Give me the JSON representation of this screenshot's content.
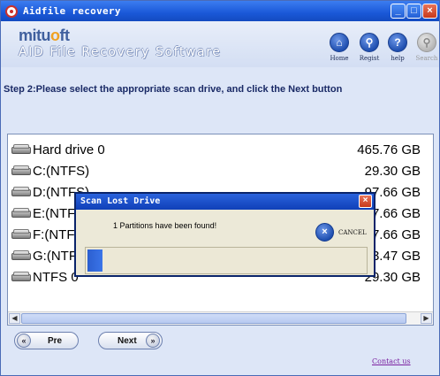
{
  "window": {
    "title": "Aidfile recovery",
    "controls": {
      "minimize": "_",
      "maximize": "□",
      "close": "×"
    }
  },
  "brand": {
    "logo_prefix": "mitu",
    "logo_o": "o",
    "logo_suffix": "ft",
    "product_name": "AID File Recovery Software"
  },
  "nav": [
    {
      "label": "Home",
      "icon": "home-icon",
      "glyph": "⌂",
      "enabled": true
    },
    {
      "label": "Regist",
      "icon": "key-icon",
      "glyph": "⚲",
      "enabled": true
    },
    {
      "label": "help",
      "icon": "help-icon",
      "glyph": "?",
      "enabled": true
    },
    {
      "label": "Search",
      "icon": "search-icon",
      "glyph": "⚲",
      "enabled": false
    }
  ],
  "step_text": "Step 2:Please select the appropriate scan drive, and click the Next button",
  "drives": [
    {
      "name": "Hard drive 0",
      "size": "465.76 GB"
    },
    {
      "name": "C:(NTFS)",
      "size": "29.30 GB"
    },
    {
      "name": "D:(NTFS)",
      "size": "97.66 GB"
    },
    {
      "name": "E:(NTFS)",
      "size": "97.66 GB"
    },
    {
      "name": "F:(NTFS)",
      "size": "97.66 GB"
    },
    {
      "name": "G:(NTFS)",
      "size": "113.47 GB"
    },
    {
      "name": "NTFS 0",
      "size": "29.30 GB"
    }
  ],
  "scrollbar": {
    "left_arrow": "◀",
    "right_arrow": "▶"
  },
  "buttons": {
    "pre": {
      "label": "Pre",
      "arrow": "«"
    },
    "next": {
      "label": "Next",
      "arrow": "»"
    }
  },
  "contact_link": "Contact us",
  "dialog": {
    "title": "Scan Lost Drive",
    "close": "×",
    "message": "1 Partitions have been found!",
    "cancel_label": "CANCEL",
    "cancel_glyph": "×",
    "progress_fraction": 0.055
  },
  "colors": {
    "titlebar": "#1a58d8",
    "window_bg": "#dde6f7",
    "progress_fill": "#2c5fd0",
    "link": "#7a1fa0"
  }
}
